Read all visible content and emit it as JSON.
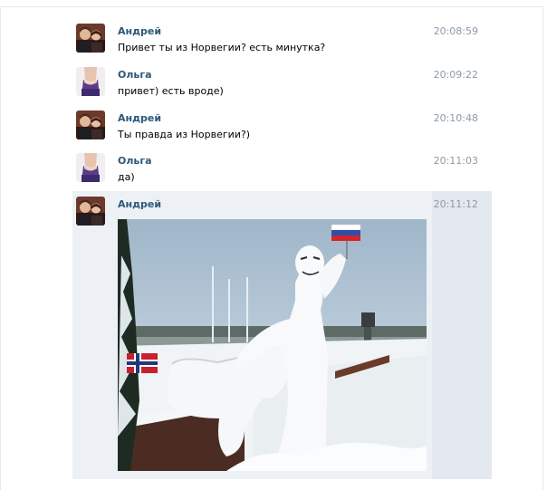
{
  "messages": [
    {
      "author": "Андрей",
      "text": "Привет ты из Норвегии? есть минутка?",
      "time": "20:08:59",
      "avatar_icon": "couple-photo-avatar"
    },
    {
      "author": "Ольга",
      "text": "привет) есть вроде)",
      "time": "20:09:22",
      "avatar_icon": "woman-photo-avatar"
    },
    {
      "author": "Андрей",
      "text": "Ты правда из Норвегии?)",
      "time": "20:10:48",
      "avatar_icon": "couple-photo-avatar"
    },
    {
      "author": "Ольга",
      "text": "да)",
      "time": "20:11:03",
      "avatar_icon": "woman-photo-avatar"
    },
    {
      "author": "Андрей",
      "time": "20:11:12",
      "avatar_icon": "couple-photo-avatar",
      "attachment": "photo"
    }
  ],
  "colors": {
    "author_link": "#2b587a",
    "timestamp": "#8d9aa8",
    "highlight_row": "#edf1f5",
    "border": "#e4e8ed"
  }
}
